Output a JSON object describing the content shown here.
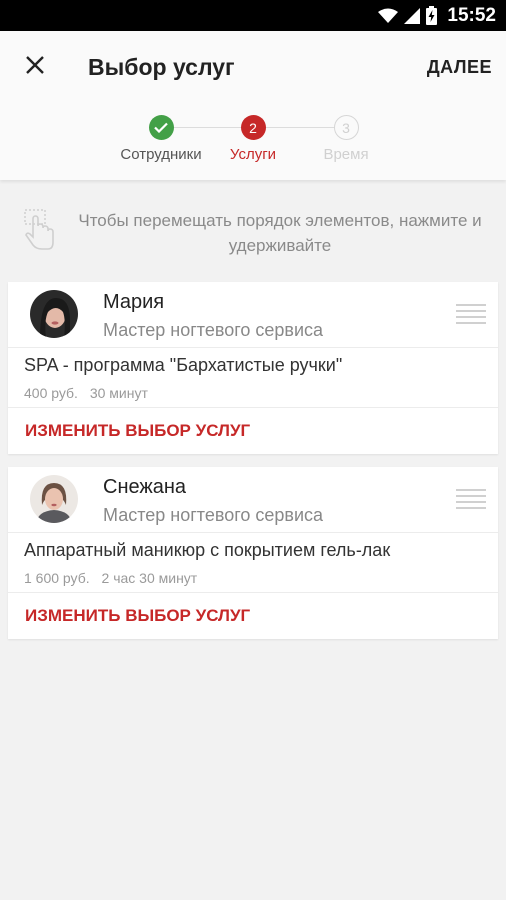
{
  "status_bar": {
    "time": "15:52",
    "icons": [
      "wifi-icon",
      "signal-icon",
      "battery-charging-icon"
    ]
  },
  "app_bar": {
    "title": "Выбор услуг",
    "next_label": "ДАЛЕЕ",
    "close_icon": "close-icon"
  },
  "stepper": {
    "steps": [
      {
        "number": "1",
        "label": "Сотрудники",
        "state": "done"
      },
      {
        "number": "2",
        "label": "Услуги",
        "state": "active"
      },
      {
        "number": "3",
        "label": "Время",
        "state": "upcoming"
      }
    ]
  },
  "hint": {
    "text": "Чтобы перемещать порядок элементов, нажмите и удерживайте",
    "icon": "touch-hold-icon"
  },
  "bookings": [
    {
      "name": "Мария",
      "role": "Мастер ногтевого сервиса",
      "service": "SPA - программа \"Бархатистые ручки\"",
      "price": "400 руб.",
      "duration": "30 минут",
      "change_label": "ИЗМЕНИТЬ ВЫБОР УСЛУГ"
    },
    {
      "name": "Снежана",
      "role": "Мастер ногтевого сервиса",
      "service": "Аппаратный маникюр с покрытием гель-лак",
      "price": "1 600 руб.",
      "duration": "2 час 30 минут",
      "change_label": "ИЗМЕНИТЬ ВЫБОР УСЛУГ"
    }
  ],
  "colors": {
    "accent": "#c62828",
    "done": "#43a047",
    "upcoming": "#d0d0d0",
    "background": "#f2f2f2"
  }
}
